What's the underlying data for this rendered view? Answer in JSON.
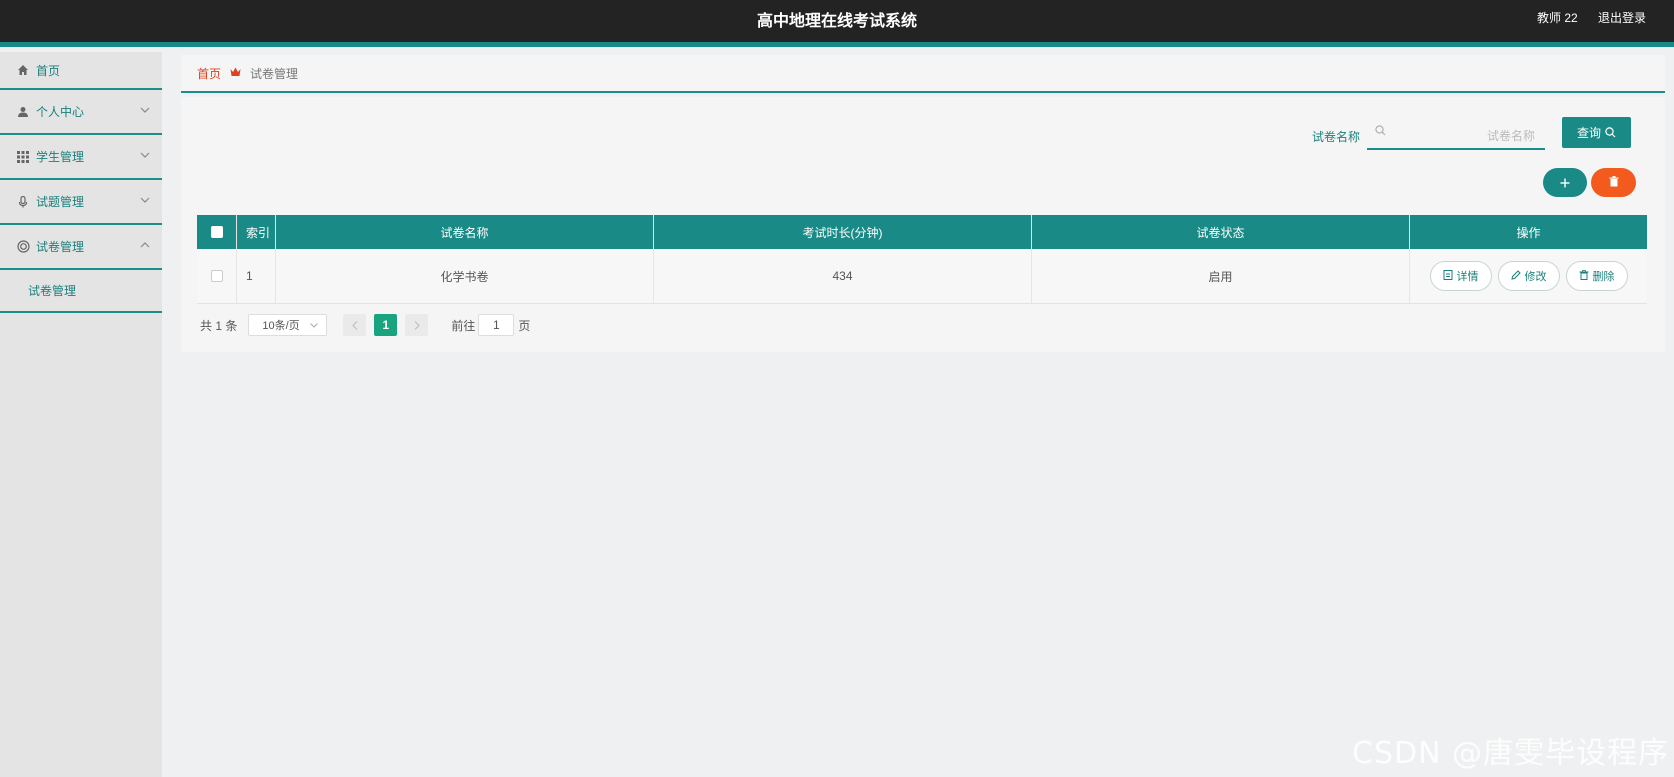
{
  "header": {
    "title": "高中地理在线考试系统",
    "user": "教师 22",
    "logout": "退出登录"
  },
  "sidebar": {
    "items": [
      {
        "label": "首页",
        "icon": "home-icon"
      },
      {
        "label": "个人中心",
        "icon": "user-icon"
      },
      {
        "label": "学生管理",
        "icon": "grid-icon"
      },
      {
        "label": "试题管理",
        "icon": "mic-icon"
      },
      {
        "label": "试卷管理",
        "icon": "circle-icon"
      }
    ],
    "sub_item": "试卷管理"
  },
  "breadcrumb": {
    "home": "首页",
    "current": "试卷管理"
  },
  "search": {
    "label": "试卷名称",
    "placeholder": "试卷名称",
    "button": "查询"
  },
  "table": {
    "headers": [
      "索引",
      "试卷名称",
      "考试时长(分钟)",
      "试卷状态",
      "操作"
    ],
    "rows": [
      {
        "index": "1",
        "name": "化学书卷",
        "duration": "434",
        "status": "启用"
      }
    ],
    "actions": {
      "detail": "详情",
      "edit": "修改",
      "delete": "删除"
    }
  },
  "pagination": {
    "total": "共 1 条",
    "page_size": "10条/页",
    "current_page": "1",
    "goto_label": "前往",
    "goto_value": "1",
    "page_suffix": "页"
  },
  "watermark": "CSDN @唐雯毕设程序",
  "colors": {
    "primary": "#1a8a86",
    "danger": "#f25a1e",
    "topbar": "#232323"
  }
}
